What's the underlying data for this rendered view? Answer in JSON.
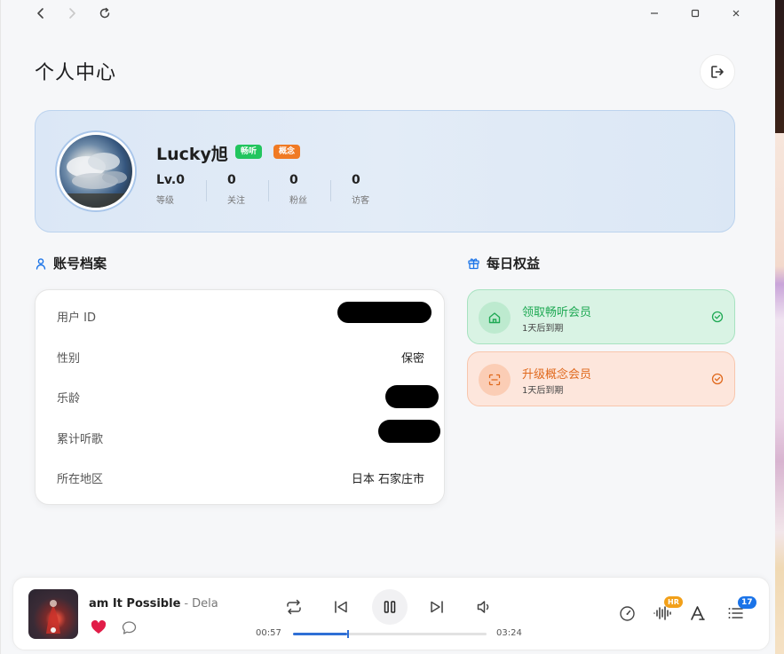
{
  "titlebar": {
    "icons": [
      "back-icon",
      "forward-icon",
      "refresh-icon",
      "minimize-icon",
      "maximize-icon",
      "close-icon"
    ]
  },
  "header": {
    "title": "个人中心",
    "logout_icon": "logout-icon"
  },
  "profile": {
    "username": "Lucky旭",
    "badges": [
      "畅听",
      "概念"
    ],
    "stats": [
      {
        "value": "Lv.0",
        "label": "等级"
      },
      {
        "value": "0",
        "label": "关注"
      },
      {
        "value": "0",
        "label": "粉丝"
      },
      {
        "value": "0",
        "label": "访客"
      }
    ]
  },
  "account": {
    "heading": "账号档案",
    "rows": [
      {
        "label": "用户 ID",
        "value": ""
      },
      {
        "label": "性别",
        "value": "保密"
      },
      {
        "label": "乐龄",
        "value": ""
      },
      {
        "label": "累计听歌",
        "value": ""
      },
      {
        "label": "所在地区",
        "value": "日本 石家庄市"
      }
    ]
  },
  "benefits": {
    "heading": "每日权益",
    "items": [
      {
        "title": "领取畅听会员",
        "subtitle": "1天后到期",
        "color": "#1fa954",
        "icon": "home-icon"
      },
      {
        "title": "升级概念会员",
        "subtitle": "1天后到期",
        "color": "#e0691d",
        "icon": "scan-icon"
      }
    ]
  },
  "player": {
    "song_title": "am It Possible",
    "separator": "-",
    "artist": "Delac",
    "liked": true,
    "current_time": "00:57",
    "total_time": "03:24",
    "progress": 0.28,
    "hr_badge": "HR",
    "queue_count": "17",
    "colors": {
      "accent": "#2f6fd6",
      "like": "#e11d48"
    }
  }
}
